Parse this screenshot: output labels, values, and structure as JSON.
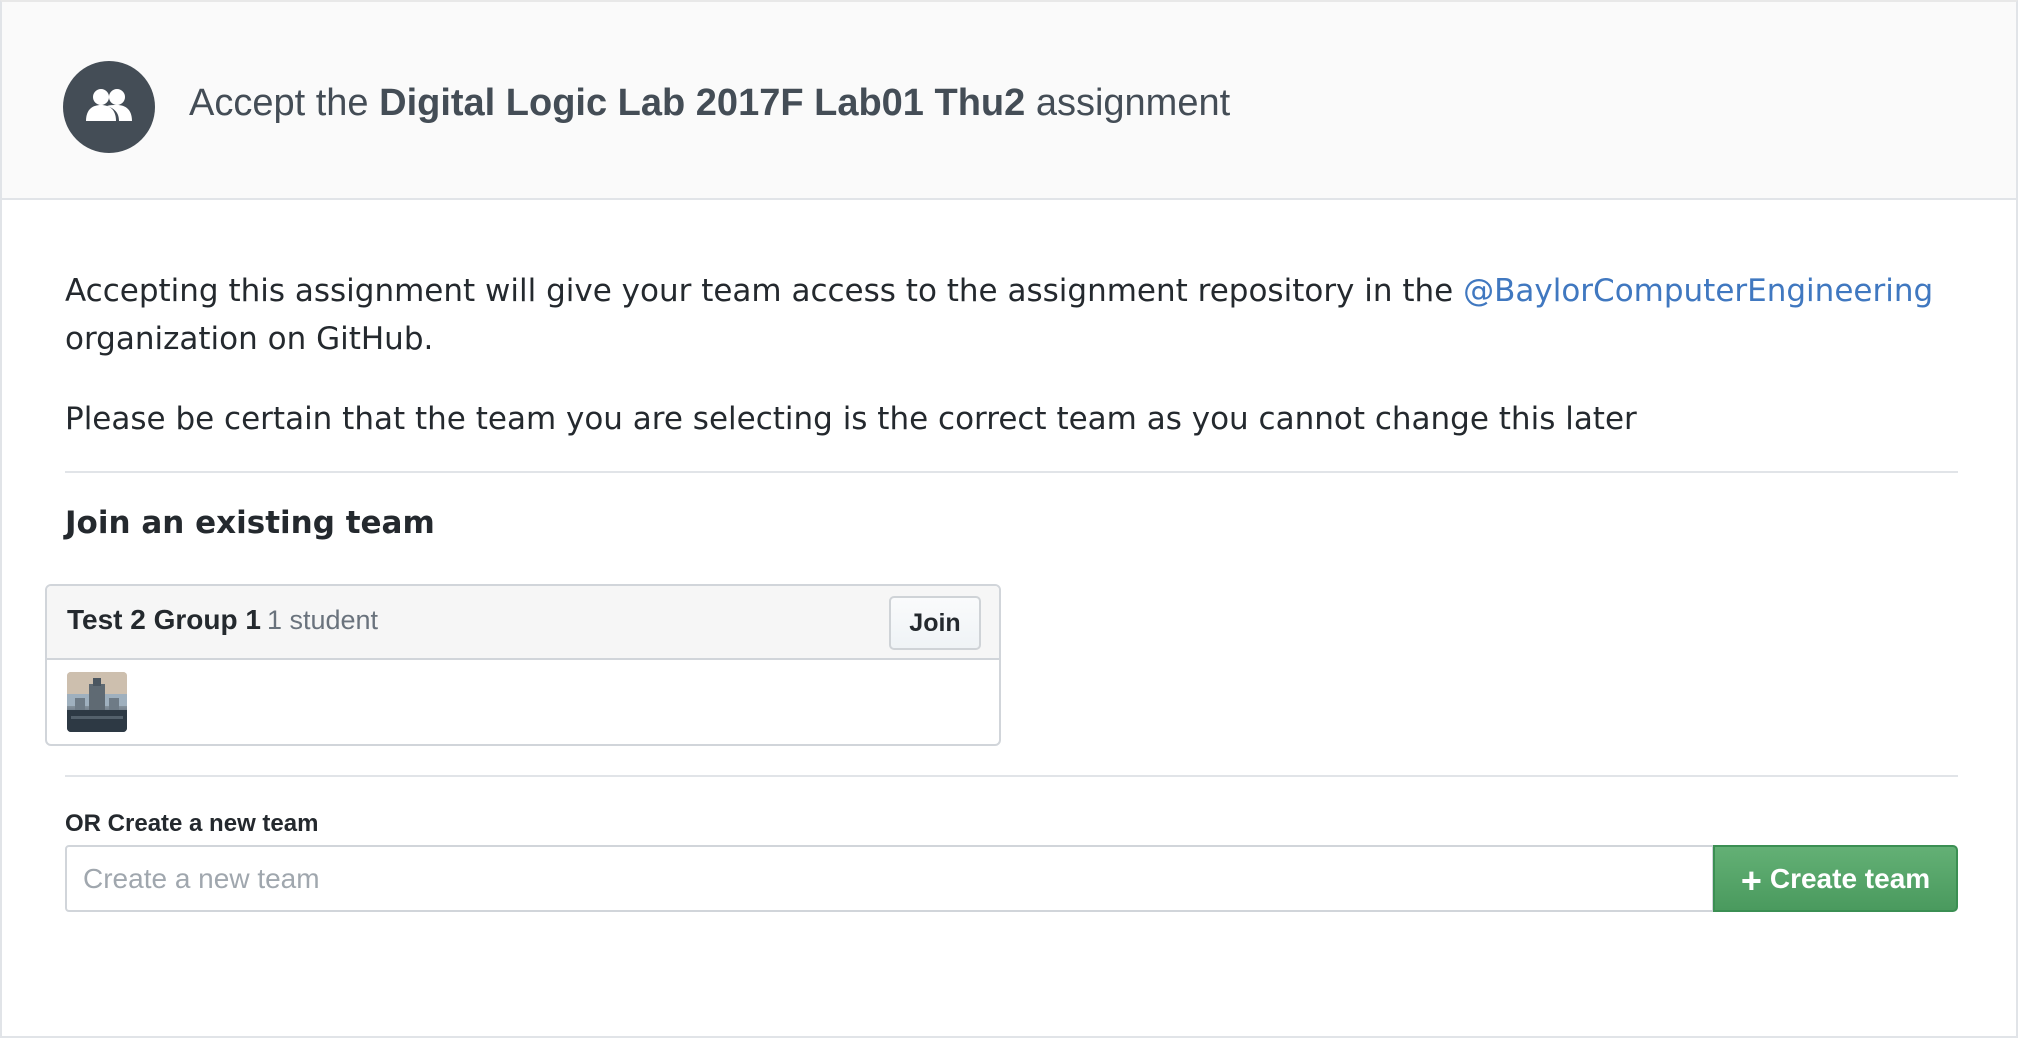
{
  "header": {
    "title_prefix": "Accept the",
    "assignment_name": "Digital Logic Lab 2017F Lab01 Thu2",
    "title_suffix": "assignment",
    "icon": "team-icon"
  },
  "intro": {
    "text_before": "Accepting this assignment will give your team access to the assignment repository in the",
    "organization_link": "@BaylorComputerEngineering",
    "text_after": "organization on GitHub."
  },
  "warning": "Please be certain that the team you are selecting is the correct team as you cannot change this later",
  "join_section": {
    "title": "Join an existing team",
    "teams": [
      {
        "name": "Test 2 Group 1",
        "member_count": "1 student",
        "join_label": "Join"
      }
    ]
  },
  "create_section": {
    "label": "OR Create a new team",
    "placeholder": "Create a new team",
    "button_label": "Create team",
    "button_icon": "plus-icon"
  },
  "colors": {
    "link": "#4078c0",
    "create_button": "#55a567",
    "header_bg": "#fafafa"
  }
}
